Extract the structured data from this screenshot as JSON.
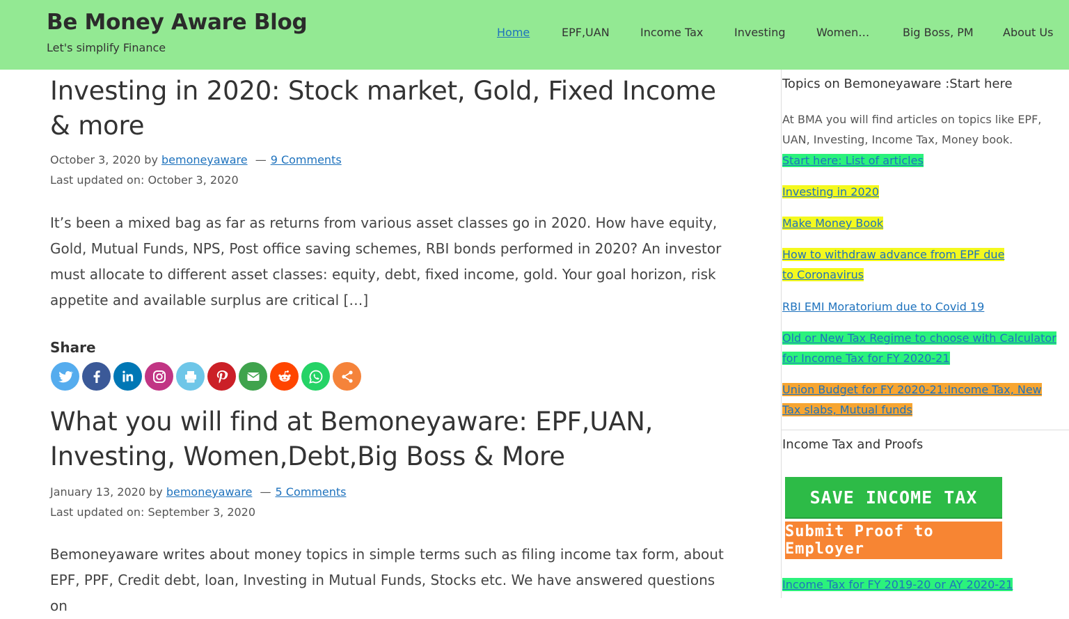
{
  "header": {
    "site_title": "Be Money Aware Blog",
    "tagline": "Let's simplify Finance",
    "bg_color": "#93e993",
    "nav": [
      {
        "label": "Home",
        "current": true
      },
      {
        "label": "EPF,UAN"
      },
      {
        "label": "Income Tax"
      },
      {
        "label": "Investing"
      },
      {
        "label": "Women…"
      },
      {
        "label": "Big Boss, PM"
      },
      {
        "label": "About Us"
      }
    ]
  },
  "posts": [
    {
      "title": "Investing in 2020: Stock market, Gold, Fixed Income & more",
      "date": "October 3, 2020",
      "by": "by",
      "author": "bemoneyaware",
      "separator": "—",
      "comments": "9 Comments",
      "updated": "Last updated on: October 3, 2020",
      "excerpt": "It’s been a mixed bag as far as returns from various asset classes go in 2020. How have equity, Gold, Mutual Funds, NPS, Post office saving schemes, RBI bonds performed in 2020? An investor must allocate to different asset classes: equity, debt, fixed income, gold. Your goal horizon, risk appetite and available surplus are critical […]",
      "share_label": "Share"
    },
    {
      "title": "What you will find at Bemoneyaware: EPF,UAN, Investing, Women,Debt,Big Boss & More",
      "date": "January 13, 2020",
      "by": "by",
      "author": "bemoneyaware",
      "separator": "—",
      "comments": "5 Comments",
      "updated": "Last updated on: September 3, 2020",
      "excerpt": "Bemoneyaware writes about money topics in simple terms such as filing income tax form, about EPF, PPF, Credit debt, loan, Investing in Mutual Funds, Stocks etc. We have answered questions on"
    }
  ],
  "share_buttons": [
    {
      "icon": "twitter-icon",
      "color": "#55acee"
    },
    {
      "icon": "facebook-icon",
      "color": "#3b5998"
    },
    {
      "icon": "linkedin-icon",
      "color": "#0077b5"
    },
    {
      "icon": "instagram-icon",
      "color": "#c13584"
    },
    {
      "icon": "print-icon",
      "color": "#6ec6e8"
    },
    {
      "icon": "pinterest-icon",
      "color": "#cb2027"
    },
    {
      "icon": "email-icon",
      "color": "#3fa34d"
    },
    {
      "icon": "reddit-icon",
      "color": "#ff4500"
    },
    {
      "icon": "whatsapp-icon",
      "color": "#25d366"
    },
    {
      "icon": "more-share-icon",
      "color": "#f5833a"
    }
  ],
  "sidebar": {
    "topics_title": "Topics on Bemoneyaware :Start here",
    "topics_text": "At BMA you will find articles on topics like EPF, UAN, Investing, Income Tax, Money book.",
    "links": [
      {
        "label": "Start here: List of articles",
        "highlight": "#2bf27c"
      },
      {
        "label": "Investing in 2020",
        "highlight": "#f4f91e"
      },
      {
        "label": "Make Money Book",
        "highlight": "#f4f91e"
      },
      {
        "label": "How to withdraw advance from EPF due to Coronavirus",
        "highlight": "#f4f91e"
      },
      {
        "label": "RBI EMI Moratorium due to Covid 19",
        "highlight": "none"
      },
      {
        "label": "Old or New Tax Regime to choose with Calculator for Income Tax for FY 2020-21",
        "highlight": "#2bf27c"
      },
      {
        "label": "Union Budget for FY 2020-21:Income Tax, New Tax slabs, Mutual funds",
        "highlight": "#f7a531"
      }
    ],
    "income_tax_title": "Income Tax and Proofs",
    "banner_save": "SAVE INCOME TAX",
    "banner_proof": "Submit Proof to Employer",
    "bottom_link": "Income Tax for FY 2019-20 or AY 2020-21"
  }
}
